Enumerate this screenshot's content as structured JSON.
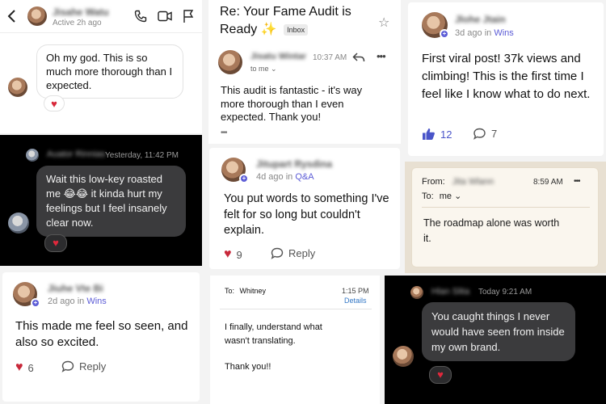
{
  "tile1": {
    "contact_name": "Jisahe Watu",
    "status": "Active 2h ago",
    "message": "Oh my god. This is so much more thorough than I expected.",
    "reaction": "♥"
  },
  "tile2": {
    "sender_name": "Auator Rinnias",
    "timestamp": "Yesterday, 11:42 PM",
    "message": "Wait this low-key roasted me 😂😂 it kinda hurt my feelings but I feel insanely clear now.",
    "reaction": "♥"
  },
  "tile3": {
    "author": "Jiuhe Vte Bi",
    "ago": "2d ago",
    "in_word": "in",
    "category": "Wins",
    "post": "This made me feel so seen, and also so excited.",
    "likes": "6",
    "reply_label": "Reply"
  },
  "tile4": {
    "subject": "Re: Your Fame Audit is Ready ✨",
    "inbox_tag": "Inbox",
    "sender": "Jisatu Wintar",
    "time": "10:37 AM",
    "to_label": "to me ⌄",
    "body": "This audit is fantastic - it's way more thorough than I even expected. Thank you!",
    "more": "•••"
  },
  "tile5": {
    "author": "Jitupart Rysdina",
    "ago": "4d ago",
    "in_word": "in",
    "category": "Q&A",
    "post": "You put words to something I've felt for so long but couldn't explain.",
    "likes": "9",
    "reply_label": "Reply"
  },
  "tile6": {
    "to_label": "To:",
    "to_name": "Whitney",
    "time": "1:15 PM",
    "details": "Details",
    "body1": "I finally, understand what wasn't translating.",
    "body2": "Thank you!!"
  },
  "tile7": {
    "author": "Jlohe Jtain",
    "ago": "3d ago",
    "in_word": "in",
    "category": "Wins",
    "post": "First viral post! 37k views and climbing! This is the first time I feel like I know what to do next.",
    "likes": "12",
    "comments": "7"
  },
  "tile8": {
    "from_label": "From:",
    "from_name": "Jita Wlann",
    "time": "8:59 AM",
    "more": "•••",
    "to_label": "To:",
    "to_name": "me ⌄",
    "body": "The roadmap alone was worth it."
  },
  "tile9": {
    "sender_name": "Hlan Slita",
    "timestamp": "Today 9:21 AM",
    "message": "You caught things I never would have seen from inside my own brand.",
    "reaction": "♥"
  }
}
